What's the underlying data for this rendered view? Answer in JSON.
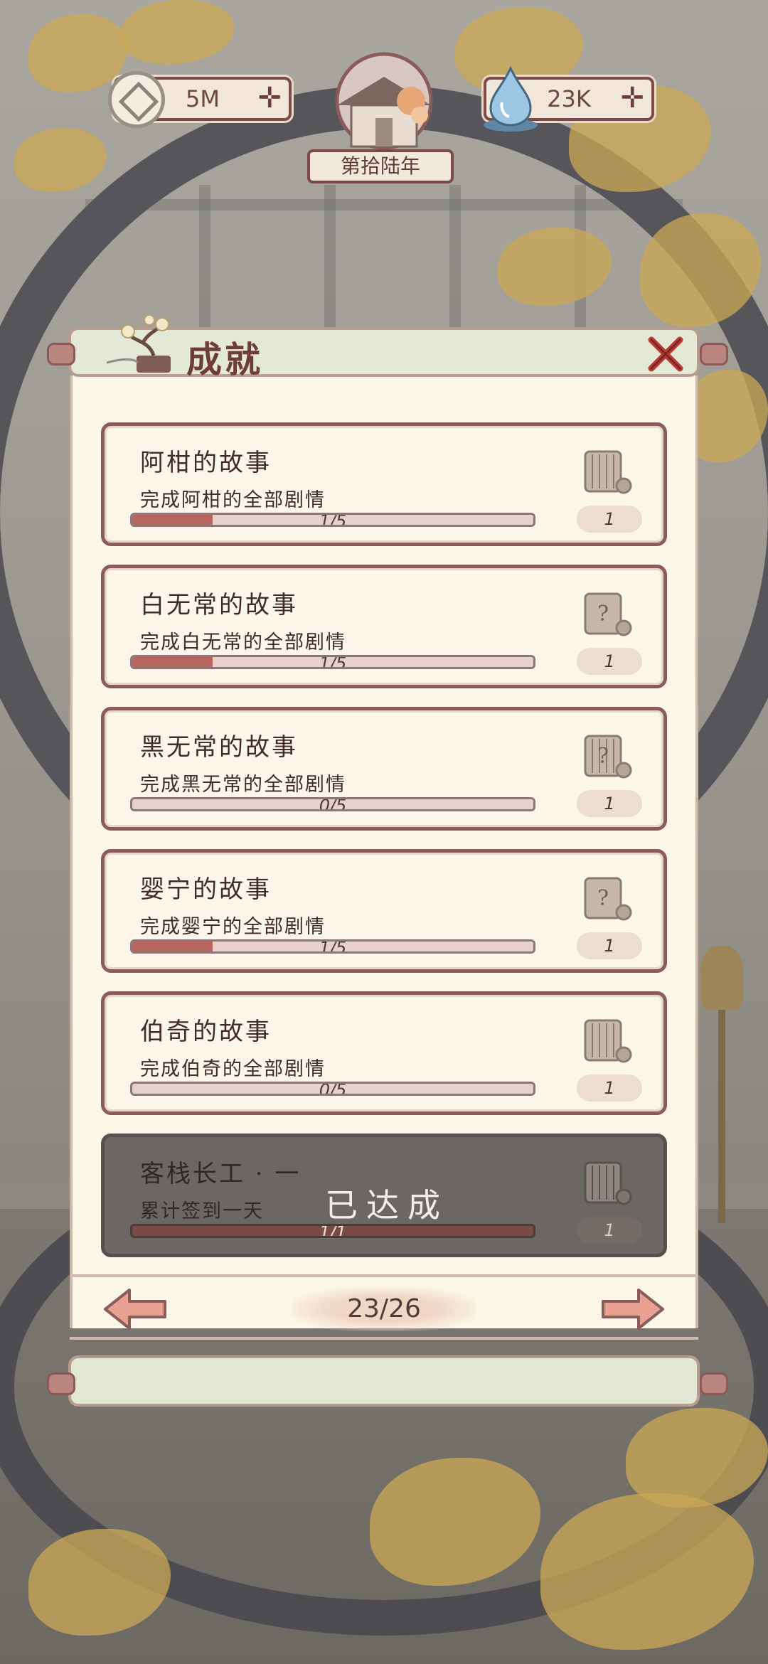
{
  "top_bar": {
    "coins": "5M",
    "spirit": "23K",
    "year": "第拾陆年"
  },
  "panel": {
    "title": "成就"
  },
  "achievements": [
    {
      "title": "阿柑的故事",
      "desc": "完成阿柑的全部剧情",
      "progress": "1/5",
      "fraction": 0.2,
      "reward": "1",
      "done": false
    },
    {
      "title": "白无常的故事",
      "desc": "完成白无常的全部剧情",
      "progress": "1/5",
      "fraction": 0.2,
      "reward": "1",
      "done": false
    },
    {
      "title": "黑无常的故事",
      "desc": "完成黑无常的全部剧情",
      "progress": "0/5",
      "fraction": 0,
      "reward": "1",
      "done": false
    },
    {
      "title": "婴宁的故事",
      "desc": "完成婴宁的全部剧情",
      "progress": "1/5",
      "fraction": 0.2,
      "reward": "1",
      "done": false
    },
    {
      "title": "伯奇的故事",
      "desc": "完成伯奇的全部剧情",
      "progress": "0/5",
      "fraction": 0,
      "reward": "1",
      "done": false
    },
    {
      "title": "客栈长工 · 一",
      "desc": "累计签到一天",
      "progress": "1/1",
      "fraction": 1,
      "reward": "1",
      "done": true,
      "done_label": "已达成"
    }
  ],
  "pagination": {
    "page": "23/26"
  },
  "colors": {
    "accent": "#8a5d5c",
    "progress_fill": "#b8665d",
    "panel_bg": "#fbf7e8"
  }
}
